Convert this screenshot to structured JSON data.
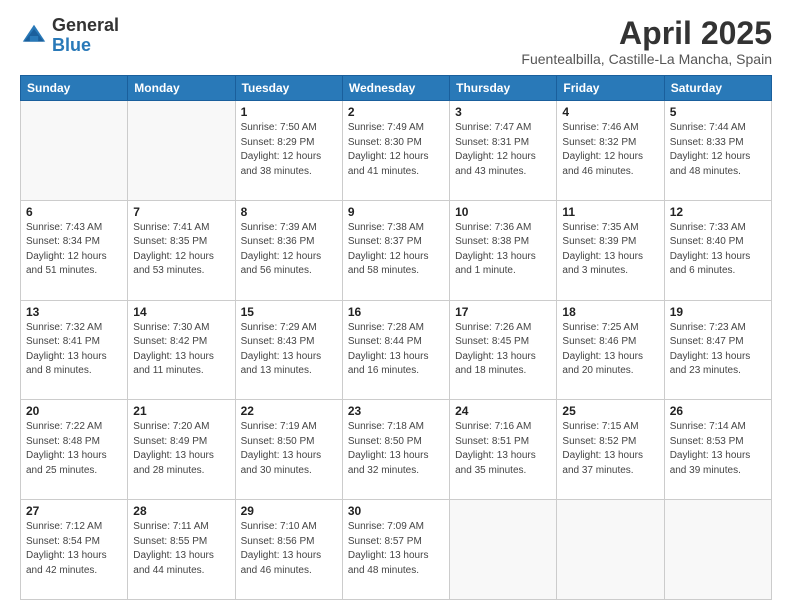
{
  "logo": {
    "general": "General",
    "blue": "Blue"
  },
  "title": "April 2025",
  "subtitle": "Fuentealbilla, Castille-La Mancha, Spain",
  "weekdays": [
    "Sunday",
    "Monday",
    "Tuesday",
    "Wednesday",
    "Thursday",
    "Friday",
    "Saturday"
  ],
  "weeks": [
    [
      {
        "day": "",
        "info": ""
      },
      {
        "day": "",
        "info": ""
      },
      {
        "day": "1",
        "info": "Sunrise: 7:50 AM\nSunset: 8:29 PM\nDaylight: 12 hours and 38 minutes."
      },
      {
        "day": "2",
        "info": "Sunrise: 7:49 AM\nSunset: 8:30 PM\nDaylight: 12 hours and 41 minutes."
      },
      {
        "day": "3",
        "info": "Sunrise: 7:47 AM\nSunset: 8:31 PM\nDaylight: 12 hours and 43 minutes."
      },
      {
        "day": "4",
        "info": "Sunrise: 7:46 AM\nSunset: 8:32 PM\nDaylight: 12 hours and 46 minutes."
      },
      {
        "day": "5",
        "info": "Sunrise: 7:44 AM\nSunset: 8:33 PM\nDaylight: 12 hours and 48 minutes."
      }
    ],
    [
      {
        "day": "6",
        "info": "Sunrise: 7:43 AM\nSunset: 8:34 PM\nDaylight: 12 hours and 51 minutes."
      },
      {
        "day": "7",
        "info": "Sunrise: 7:41 AM\nSunset: 8:35 PM\nDaylight: 12 hours and 53 minutes."
      },
      {
        "day": "8",
        "info": "Sunrise: 7:39 AM\nSunset: 8:36 PM\nDaylight: 12 hours and 56 minutes."
      },
      {
        "day": "9",
        "info": "Sunrise: 7:38 AM\nSunset: 8:37 PM\nDaylight: 12 hours and 58 minutes."
      },
      {
        "day": "10",
        "info": "Sunrise: 7:36 AM\nSunset: 8:38 PM\nDaylight: 13 hours and 1 minute."
      },
      {
        "day": "11",
        "info": "Sunrise: 7:35 AM\nSunset: 8:39 PM\nDaylight: 13 hours and 3 minutes."
      },
      {
        "day": "12",
        "info": "Sunrise: 7:33 AM\nSunset: 8:40 PM\nDaylight: 13 hours and 6 minutes."
      }
    ],
    [
      {
        "day": "13",
        "info": "Sunrise: 7:32 AM\nSunset: 8:41 PM\nDaylight: 13 hours and 8 minutes."
      },
      {
        "day": "14",
        "info": "Sunrise: 7:30 AM\nSunset: 8:42 PM\nDaylight: 13 hours and 11 minutes."
      },
      {
        "day": "15",
        "info": "Sunrise: 7:29 AM\nSunset: 8:43 PM\nDaylight: 13 hours and 13 minutes."
      },
      {
        "day": "16",
        "info": "Sunrise: 7:28 AM\nSunset: 8:44 PM\nDaylight: 13 hours and 16 minutes."
      },
      {
        "day": "17",
        "info": "Sunrise: 7:26 AM\nSunset: 8:45 PM\nDaylight: 13 hours and 18 minutes."
      },
      {
        "day": "18",
        "info": "Sunrise: 7:25 AM\nSunset: 8:46 PM\nDaylight: 13 hours and 20 minutes."
      },
      {
        "day": "19",
        "info": "Sunrise: 7:23 AM\nSunset: 8:47 PM\nDaylight: 13 hours and 23 minutes."
      }
    ],
    [
      {
        "day": "20",
        "info": "Sunrise: 7:22 AM\nSunset: 8:48 PM\nDaylight: 13 hours and 25 minutes."
      },
      {
        "day": "21",
        "info": "Sunrise: 7:20 AM\nSunset: 8:49 PM\nDaylight: 13 hours and 28 minutes."
      },
      {
        "day": "22",
        "info": "Sunrise: 7:19 AM\nSunset: 8:50 PM\nDaylight: 13 hours and 30 minutes."
      },
      {
        "day": "23",
        "info": "Sunrise: 7:18 AM\nSunset: 8:50 PM\nDaylight: 13 hours and 32 minutes."
      },
      {
        "day": "24",
        "info": "Sunrise: 7:16 AM\nSunset: 8:51 PM\nDaylight: 13 hours and 35 minutes."
      },
      {
        "day": "25",
        "info": "Sunrise: 7:15 AM\nSunset: 8:52 PM\nDaylight: 13 hours and 37 minutes."
      },
      {
        "day": "26",
        "info": "Sunrise: 7:14 AM\nSunset: 8:53 PM\nDaylight: 13 hours and 39 minutes."
      }
    ],
    [
      {
        "day": "27",
        "info": "Sunrise: 7:12 AM\nSunset: 8:54 PM\nDaylight: 13 hours and 42 minutes."
      },
      {
        "day": "28",
        "info": "Sunrise: 7:11 AM\nSunset: 8:55 PM\nDaylight: 13 hours and 44 minutes."
      },
      {
        "day": "29",
        "info": "Sunrise: 7:10 AM\nSunset: 8:56 PM\nDaylight: 13 hours and 46 minutes."
      },
      {
        "day": "30",
        "info": "Sunrise: 7:09 AM\nSunset: 8:57 PM\nDaylight: 13 hours and 48 minutes."
      },
      {
        "day": "",
        "info": ""
      },
      {
        "day": "",
        "info": ""
      },
      {
        "day": "",
        "info": ""
      }
    ]
  ]
}
